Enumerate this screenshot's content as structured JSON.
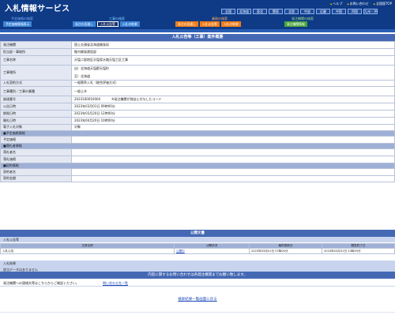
{
  "header": {
    "title": "入札情報サービス",
    "top_links": [
      "ヘルプ",
      "お問い合わせ",
      "全国版TOP"
    ],
    "regions": [
      "全国",
      "北海道",
      "東北",
      "関東",
      "北陸",
      "中部",
      "近畿",
      "中国",
      "四国",
      "九州・沖"
    ],
    "groups": {
      "search": "予定価格の検索",
      "koji": "工事の検索",
      "gyomu": "業務の検索",
      "hatchu": "発注機関の検索"
    },
    "tabs": {
      "t1": "予定価格情報表示",
      "t2": "発注の見通し",
      "t3": "入札公告等",
      "t4": "入札の結果",
      "t5": "発注の見通し",
      "t6": "入札公告等",
      "t7": "入札の結果",
      "t8": "発注機関情報"
    }
  },
  "main": {
    "title": "入札公告等（工事）案件概要",
    "rows": {
      "org_label": "発注機関",
      "org_value": "国土交通省北海道開発局",
      "office_label": "担当部・事務所",
      "office_value": "稚内開発建設部",
      "name_label": "工事名称",
      "name_value": "天塩二股地区天塩導水路天塩工区工事",
      "place_label": "工事場所",
      "place_value1": "自）北海道天塩郡天塩町",
      "place_value2": "至）北海道",
      "method_label": "入札契約方式",
      "method_value": "一般競争入札（総合評価方式）",
      "type_label": "工事種別／工事の業種",
      "type_value": "一般土木",
      "code_label": "調達番号",
      "code_value": "2023100010004",
      "code_note": "※発注機関が独自に付与したコード",
      "notice_label": "公告日時",
      "notice_value": "2023年03月01日 09時00分",
      "deadline_label": "期限日時",
      "deadline_value": "2023年03月20日 12時00分",
      "open_label": "開札日時",
      "open_value": "2023年04月20日 10時00分",
      "ebid_label": "電子入札対象",
      "ebid_value": "対象"
    },
    "sections": {
      "plan": "■予定価格情報",
      "winner": "■落札者情報",
      "contract": "■契約情報"
    },
    "sub_rows": {
      "plan_price": "予定価格",
      "winner_name": "落札者名",
      "winner_price": "落札価格",
      "contract_name": "契約者名",
      "contract_price": "契約金額"
    }
  },
  "public_docs": {
    "title": "公開文書",
    "subtitle": "入札公告等",
    "columns": [
      "文書名称",
      "公開状況",
      "最終更新日",
      "閲覧終了日"
    ],
    "row": [
      "入札公告",
      "公開中",
      "2023年03月01日 07時00分",
      "2024年03月31日 23時59分"
    ]
  },
  "no_result": {
    "title": "入札結果",
    "text": "該当データはありません"
  },
  "inquiry": {
    "bar": "内容に関するお問い合わせは各発注機関までお願い致します。",
    "text": "発注機関への連絡先等はこちらからご確認ください。",
    "link": "問い合わせ先一覧"
  },
  "footer": {
    "back": "検索結果一覧画面に戻る"
  }
}
